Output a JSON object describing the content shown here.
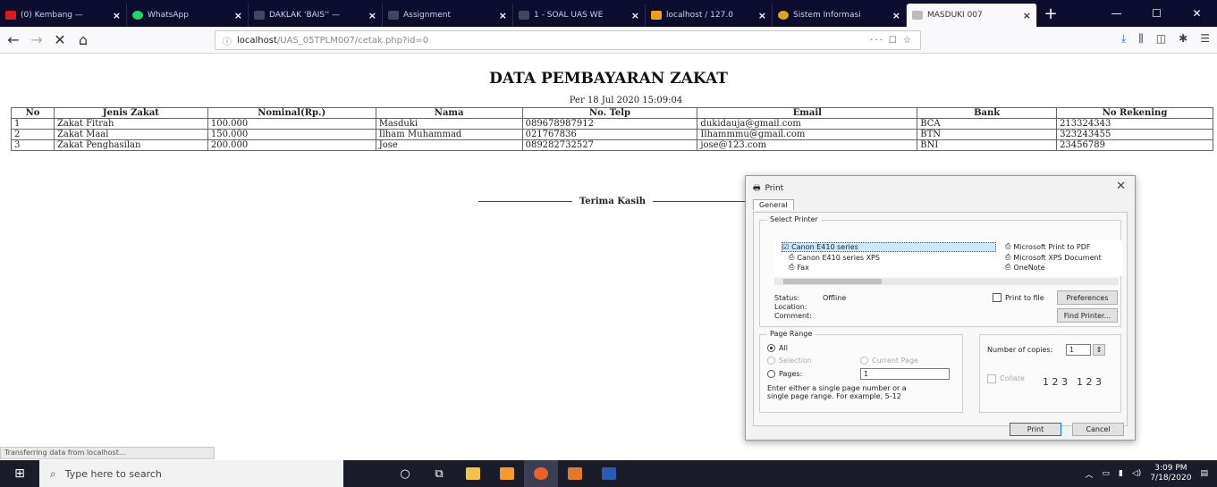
{
  "browser": {
    "tabs": [
      {
        "label": "(0) Kembang — ",
        "fav": "#d81b1b"
      },
      {
        "label": "WhatsApp",
        "fav": "#25d366"
      },
      {
        "label": "DAKLAK 'BAIS'' — ",
        "fav": "#333344"
      },
      {
        "label": "Assignment",
        "fav": "#333344"
      },
      {
        "label": "1 - SOAL UAS WE",
        "fav": "#333344"
      },
      {
        "label": "localhost / 127.0",
        "fav": "#f0a020"
      },
      {
        "label": "Sistem Informasi",
        "fav": "#e0a020"
      },
      {
        "label": "MASDUKI 007",
        "fav": "#999999"
      }
    ],
    "new_tab": "+",
    "url_host": "localhost",
    "url_path": "/UAS_05TPLM007/cetak.php?id=0",
    "url_right": "··· ☐ ☆",
    "status_text": "Transferring data from localhost..."
  },
  "page": {
    "title": "DATA PEMBAYARAN ZAKAT",
    "date": "Per 18 Jul 2020 15:09:04",
    "columns": [
      "No",
      "Jenis Zakat",
      "Nominal(Rp.)",
      "Nama",
      "No. Telp",
      "Email",
      "Bank",
      "No Rekening"
    ],
    "rows": [
      [
        "1",
        "Zakat Fitrah",
        "100.000",
        "Masduki",
        "089678987912",
        "dukidauja@gmail.com",
        "BCA",
        "213324343"
      ],
      [
        "2",
        "Zakat Maal",
        "150.000",
        "Ilham Muhammad",
        "021767836",
        "Ilhammmu@gmail.com",
        "BTN",
        "323243455"
      ],
      [
        "3",
        "Zakat Penghasilan",
        "200.000",
        "Jose",
        "089282732527",
        "jose@123.com",
        "BNI",
        "23456789"
      ]
    ],
    "thanks": "Terima Kasih"
  },
  "print_dialog": {
    "title": "Print",
    "tab": "General",
    "select_printer": "Select Printer",
    "printers": [
      "Canon E410 series",
      "Canon E410 series XPS",
      "Fax",
      "Microsoft Print to PDF",
      "Microsoft XPS Document",
      "OneNote"
    ],
    "status_label": "Status:",
    "status_value": "Offline",
    "location_label": "Location:",
    "comment_label": "Comment:",
    "print_to_file": "Print to file",
    "preferences": "Preferences",
    "find_printer": "Find Printer...",
    "page_range": "Page Range",
    "all": "All",
    "selection": "Selection",
    "current_page": "Current Page",
    "pages": "Pages:",
    "pages_value": "1",
    "hint": "Enter either a single page number or a single page range.  For example, 5-12",
    "copies_label": "Number of copies:",
    "copies_value": "1",
    "collate": "Collate",
    "collate_a": "1 2 3",
    "collate_b": "1 2 3",
    "print_btn": "Print",
    "cancel_btn": "Cancel"
  },
  "taskbar": {
    "search_placeholder": "Type here to search",
    "time": "3:09 PM",
    "date": "7/18/2020"
  }
}
